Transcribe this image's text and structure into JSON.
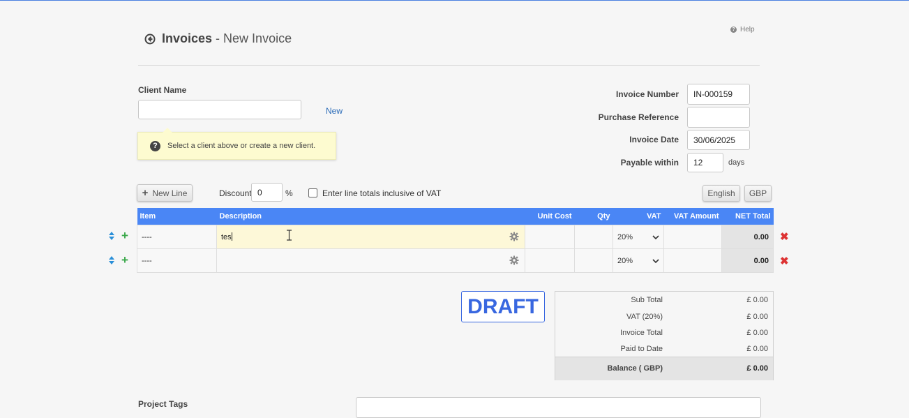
{
  "header": {
    "title": "Invoices",
    "separator": "-",
    "subtitle": "New Invoice",
    "help_label": "Help"
  },
  "client": {
    "label": "Client Name",
    "value": "",
    "new_link": "New",
    "tip": "Select a client above or create a new client."
  },
  "meta": {
    "invoice_number_label": "Invoice Number",
    "invoice_number": "IN-000159",
    "purchase_reference_label": "Purchase Reference",
    "purchase_reference": "",
    "invoice_date_label": "Invoice Date",
    "invoice_date": "30/06/2025",
    "payable_within_label": "Payable within",
    "payable_within": "12",
    "days_label": "days"
  },
  "toolbar": {
    "new_line_label": "New Line",
    "discount_label": "Discount",
    "discount_value": "0",
    "percent_label": "%",
    "inclusive_vat_label": "Enter line totals inclusive of VAT",
    "inclusive_vat_checked": false,
    "language_button": "English",
    "currency_button": "GBP"
  },
  "lines": {
    "columns": [
      "Item",
      "Description",
      "Unit Cost",
      "Qty",
      "VAT",
      "VAT Amount",
      "NET Total"
    ],
    "rows": [
      {
        "item": "----",
        "description": "tes",
        "unit_cost": "",
        "qty": "",
        "vat": "20%",
        "vat_amount": "",
        "net_total": "0.00"
      },
      {
        "item": "----",
        "description": "",
        "unit_cost": "",
        "qty": "",
        "vat": "20%",
        "vat_amount": "",
        "net_total": "0.00"
      }
    ]
  },
  "status": {
    "draft_label": "DRAFT"
  },
  "totals": {
    "sub_total_label": "Sub Total",
    "sub_total": "£ 0.00",
    "vat_label": "VAT (20%)",
    "vat": "£ 0.00",
    "invoice_total_label": "Invoice Total",
    "invoice_total": "£ 0.00",
    "paid_to_date_label": "Paid to Date",
    "paid_to_date": "£ 0.00",
    "balance_label": "Balance ( GBP)",
    "balance": "£ 0.00"
  },
  "project_tags": {
    "label": "Project Tags",
    "value": ""
  },
  "colors": {
    "header_bar": "#4a86f5",
    "draft": "#3867e0",
    "add": "#3aa84a",
    "delete": "#dd3333",
    "tip_background": "#fdfbd0"
  },
  "icons": [
    "back-arrow-icon",
    "help-icon",
    "question-icon",
    "plus-icon",
    "gear-icon",
    "sort-updown-icon",
    "add-line-icon",
    "delete-icon",
    "chevron-down-icon",
    "text-cursor-icon"
  ]
}
